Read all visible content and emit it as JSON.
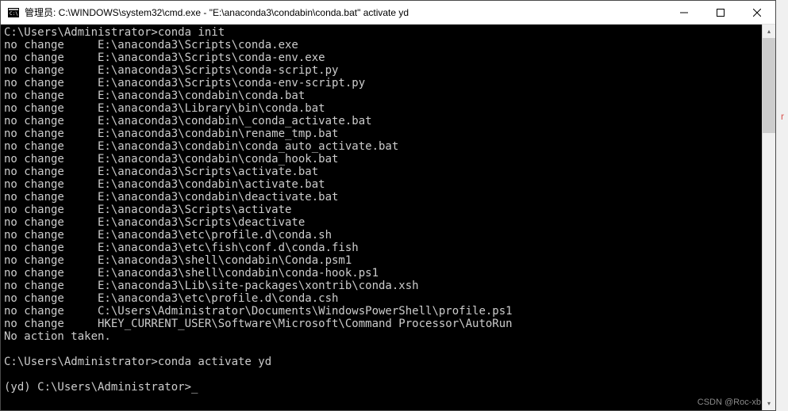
{
  "window": {
    "title": "管理员: C:\\WINDOWS\\system32\\cmd.exe - \"E:\\anaconda3\\condabin\\conda.bat\"  activate yd"
  },
  "terminal": {
    "prompt1": "C:\\Users\\Administrator>",
    "command1": "conda init",
    "lines": [
      "no change     E:\\anaconda3\\Scripts\\conda.exe",
      "no change     E:\\anaconda3\\Scripts\\conda-env.exe",
      "no change     E:\\anaconda3\\Scripts\\conda-script.py",
      "no change     E:\\anaconda3\\Scripts\\conda-env-script.py",
      "no change     E:\\anaconda3\\condabin\\conda.bat",
      "no change     E:\\anaconda3\\Library\\bin\\conda.bat",
      "no change     E:\\anaconda3\\condabin\\_conda_activate.bat",
      "no change     E:\\anaconda3\\condabin\\rename_tmp.bat",
      "no change     E:\\anaconda3\\condabin\\conda_auto_activate.bat",
      "no change     E:\\anaconda3\\condabin\\conda_hook.bat",
      "no change     E:\\anaconda3\\Scripts\\activate.bat",
      "no change     E:\\anaconda3\\condabin\\activate.bat",
      "no change     E:\\anaconda3\\condabin\\deactivate.bat",
      "no change     E:\\anaconda3\\Scripts\\activate",
      "no change     E:\\anaconda3\\Scripts\\deactivate",
      "no change     E:\\anaconda3\\etc\\profile.d\\conda.sh",
      "no change     E:\\anaconda3\\etc\\fish\\conf.d\\conda.fish",
      "no change     E:\\anaconda3\\shell\\condabin\\Conda.psm1",
      "no change     E:\\anaconda3\\shell\\condabin\\conda-hook.ps1",
      "no change     E:\\anaconda3\\Lib\\site-packages\\xontrib\\conda.xsh",
      "no change     E:\\anaconda3\\etc\\profile.d\\conda.csh",
      "no change     C:\\Users\\Administrator\\Documents\\WindowsPowerShell\\profile.ps1",
      "no change     HKEY_CURRENT_USER\\Software\\Microsoft\\Command Processor\\AutoRun",
      "No action taken."
    ],
    "blank": "",
    "prompt2": "C:\\Users\\Administrator>",
    "command2": "conda activate yd",
    "prompt3": "(yd) C:\\Users\\Administrator>",
    "cursor": "_"
  },
  "watermark": "CSDN @Roc-xb",
  "side_text": "r"
}
